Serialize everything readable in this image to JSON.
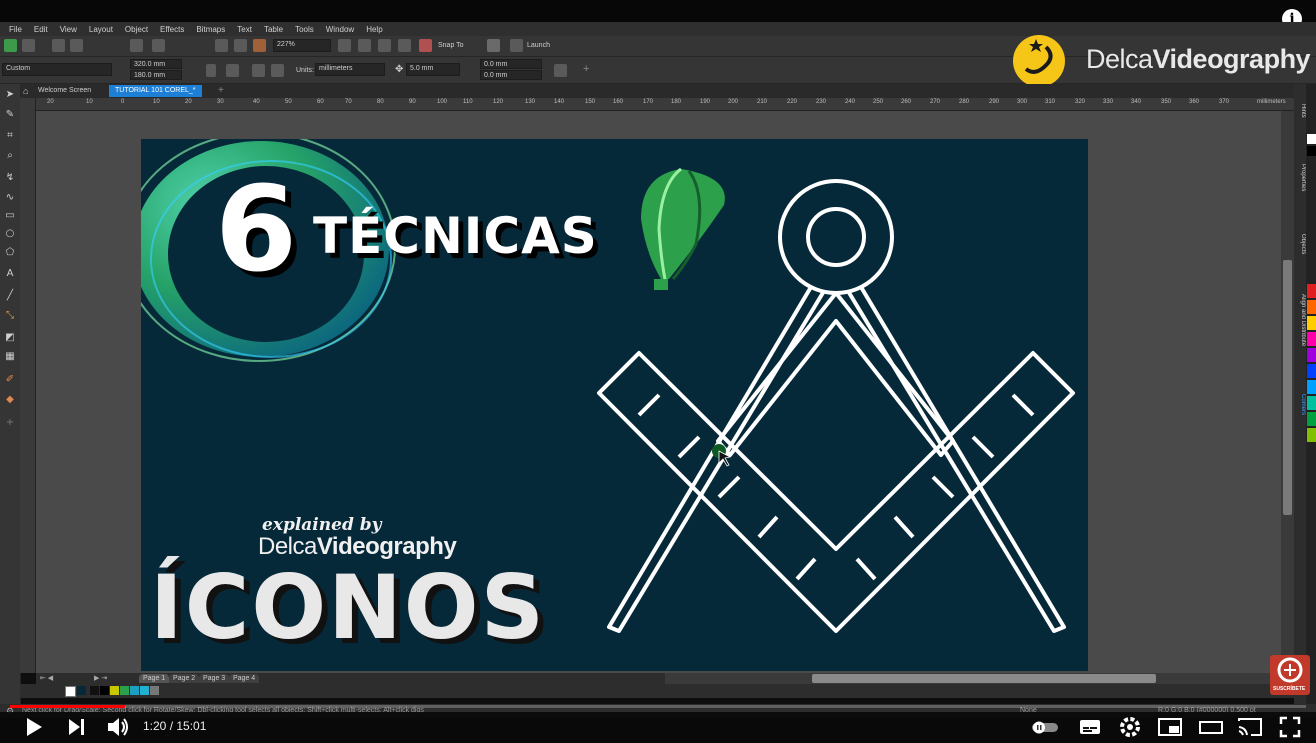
{
  "menu": [
    "File",
    "Edit",
    "View",
    "Layout",
    "Object",
    "Effects",
    "Bitmaps",
    "Text",
    "Table",
    "Tools",
    "Window",
    "Help"
  ],
  "toolbar1": {
    "zoom": "227%",
    "snap_to": "Snap To",
    "launch": "Launch"
  },
  "toolbar2": {
    "page_preset": "Custom",
    "width": "320.0 mm",
    "height": "180.0 mm",
    "units_label": "Units:",
    "units": "millimeters",
    "nudge": "5.0 mm",
    "dup_x": "0.0 mm",
    "dup_y": "0.0 mm"
  },
  "tabs": {
    "welcome": "Welcome Screen",
    "document": "TUTORIAL 101 COREL_*"
  },
  "ruler_top": [
    "20",
    "10",
    "0",
    "10",
    "20",
    "30",
    "40",
    "50",
    "60",
    "70",
    "80",
    "90",
    "100",
    "110",
    "120",
    "130",
    "140",
    "150",
    "160",
    "170",
    "180",
    "190",
    "200",
    "210",
    "220",
    "230",
    "240",
    "250",
    "260",
    "270",
    "280",
    "290",
    "300",
    "310",
    "320",
    "330",
    "340",
    "350",
    "360",
    "370"
  ],
  "ruler_unit": "millimeters",
  "pages": [
    "Page 1",
    "Page 2",
    "Page 3",
    "Page 4"
  ],
  "dockers": [
    "Hints",
    "Properties",
    "Objects",
    "Align and Distribute",
    "Comers"
  ],
  "status": {
    "hint": "Next click for Drag/Scale; Second click for Rotate/Skew; Dbl-clicking tool selects all objects; Shift+click multi-selects; Alt+click digs",
    "fill": "None",
    "outline": "R:0 G:0 B:0 (#000000)  0.500 pt"
  },
  "artwork": {
    "number": "6",
    "title": "TÉCNICAS",
    "subtitle": "ÍCONOS",
    "explained": "explained by",
    "credit_light": "Delca",
    "credit_bold": "Videography"
  },
  "brand": {
    "light": "Delca",
    "bold": "Videography"
  },
  "player": {
    "time": "1:20 / 15:01",
    "progress": 0.089
  },
  "subscribe_label": "SUSCRÍBETE",
  "colors": {
    "canvas": "#06293a",
    "accent": "#ff0000",
    "brand_yellow": "#f5c518",
    "compass": "#ffffff"
  }
}
